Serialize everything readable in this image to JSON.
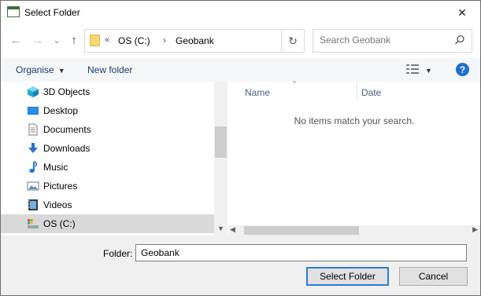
{
  "window": {
    "title": "Select Folder",
    "close_glyph": "✕"
  },
  "nav_buttons": {
    "back": "←",
    "forward": "→",
    "recent": "⌄",
    "up": "↑"
  },
  "address": {
    "overflow": "«",
    "segments": [
      "OS (C:)",
      "Geobank"
    ],
    "separator": "›",
    "refresh_glyph": "↻"
  },
  "search": {
    "placeholder": "Search Geobank"
  },
  "command_bar": {
    "organise": "Organise",
    "organise_caret": "▼",
    "new_folder": "New folder",
    "view_caret": "▼",
    "help": "?"
  },
  "nav_pane": {
    "items": [
      {
        "label": "3D Objects",
        "icon": "3d-objects-icon"
      },
      {
        "label": "Desktop",
        "icon": "desktop-icon"
      },
      {
        "label": "Documents",
        "icon": "documents-icon"
      },
      {
        "label": "Downloads",
        "icon": "downloads-icon"
      },
      {
        "label": "Music",
        "icon": "music-icon"
      },
      {
        "label": "Pictures",
        "icon": "pictures-icon"
      },
      {
        "label": "Videos",
        "icon": "videos-icon"
      },
      {
        "label": "OS (C:)",
        "icon": "drive-icon",
        "selected": true
      }
    ]
  },
  "content": {
    "columns": [
      "Name",
      "Date"
    ],
    "empty_message": "No items match your search."
  },
  "footer": {
    "folder_label": "Folder:",
    "folder_value": "Geobank",
    "select_button": "Select Folder",
    "cancel_button": "Cancel"
  },
  "colors": {
    "accent": "#2b7bd6",
    "selection": "#d9d9d9",
    "help": "#1e6fd1"
  }
}
